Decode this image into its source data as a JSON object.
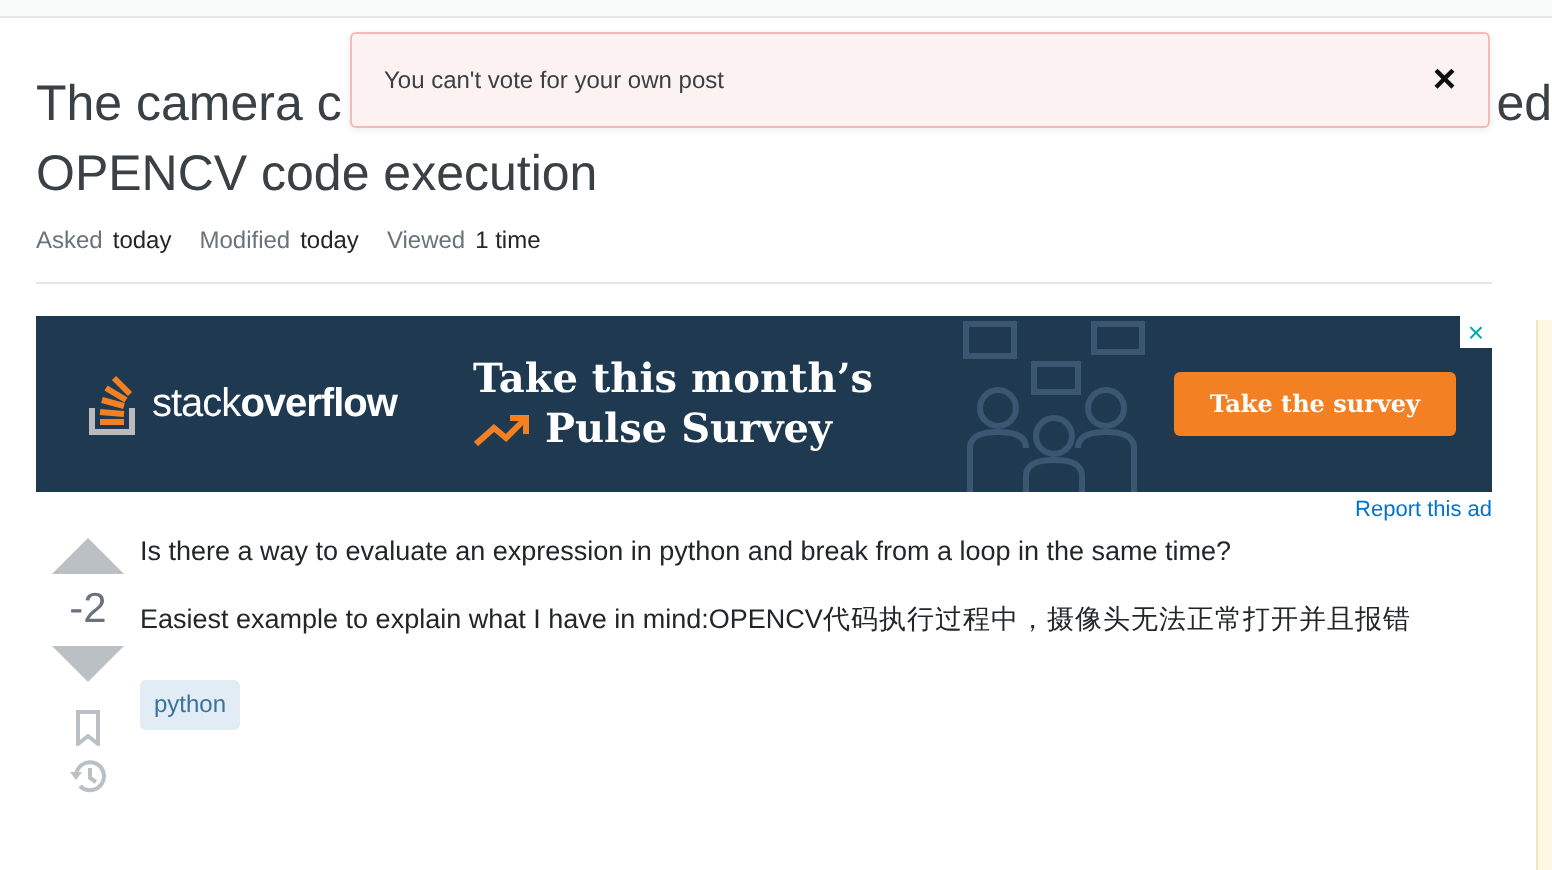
{
  "toast": {
    "message": "You can't vote for your own post",
    "close": "×"
  },
  "question": {
    "title_line1_start": "The camera c",
    "title_line1_end": "ed",
    "title_line2": "OPENCV code execution",
    "meta": [
      {
        "label": "Asked",
        "value": "today"
      },
      {
        "label": "Modified",
        "value": "today"
      },
      {
        "label": "Viewed",
        "value": "1 time"
      }
    ]
  },
  "ad": {
    "logo": "stack**overflow**",
    "headline_line1": "Take this month’s",
    "headline_line2": "Pulse Survey",
    "button": "Take the survey",
    "close": "×",
    "report": "Report this ad"
  },
  "post": {
    "score": "-2",
    "paragraphs": [
      "Is there a way to evaluate an expression in python and break from a loop in the same time?",
      "Easiest example to explain what I have in mind:OPENCV代码执行过程中，摄像头无法正常打开并且报错"
    ],
    "tags": [
      "python"
    ]
  }
}
